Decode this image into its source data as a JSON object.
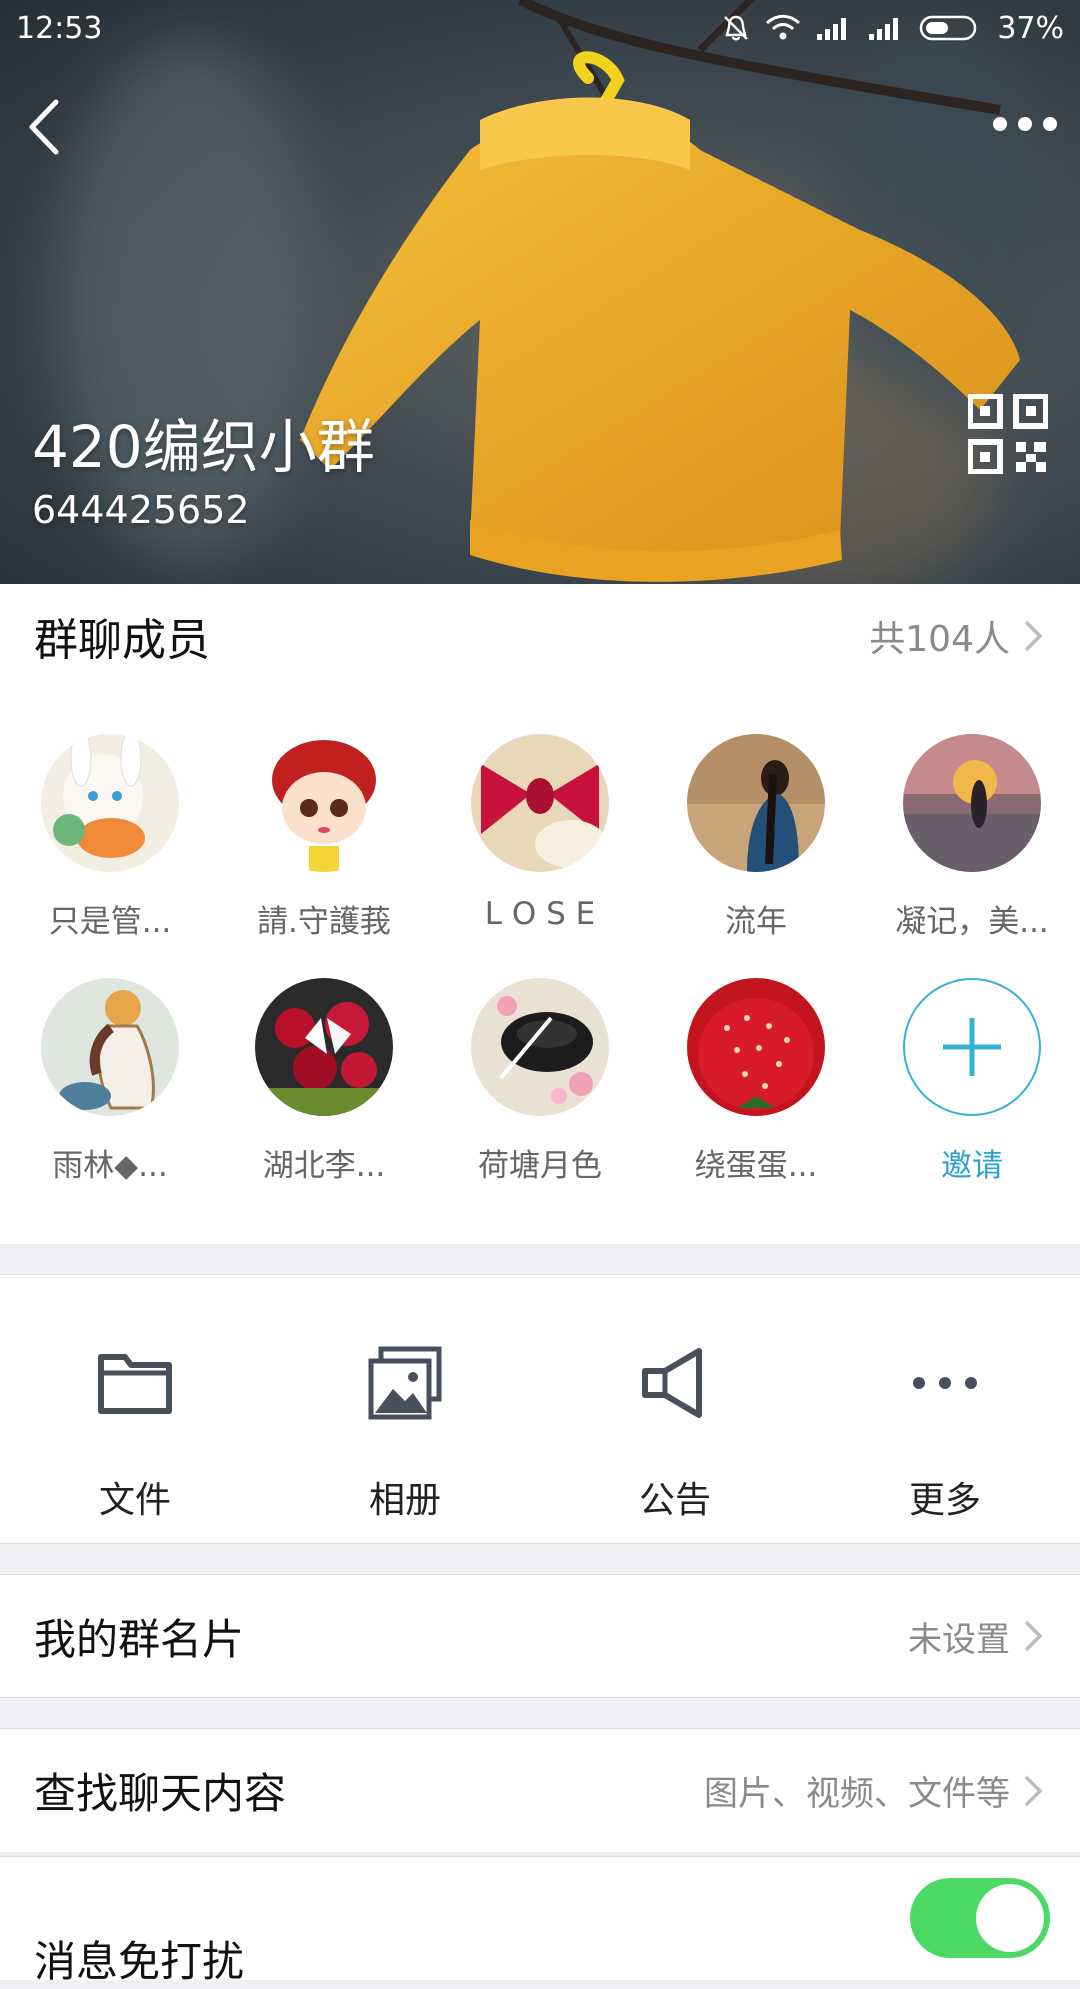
{
  "status_bar": {
    "time": "12:53",
    "battery": "37%"
  },
  "header": {
    "group_name": "420编织小群",
    "group_number": "644425652"
  },
  "members": {
    "title": "群聊成员",
    "count_label": "共104人",
    "list": [
      {
        "name": "只是管...",
        "avatar": "anime-bunny-girl"
      },
      {
        "name": "請.守護莪",
        "avatar": "cartoon-boy"
      },
      {
        "name": "L O S E",
        "avatar": "red-knit-bow"
      },
      {
        "name": "流年",
        "avatar": "silhouette-girl"
      },
      {
        "name": "凝记，美...",
        "avatar": "sunset-figure"
      },
      {
        "name": "雨林◆...",
        "avatar": "illustrated-girl"
      },
      {
        "name": "湖北李...",
        "avatar": "flower-bouquet"
      },
      {
        "name": "荷塘月色",
        "avatar": "tea-cup-flowers"
      },
      {
        "name": "绕蛋蛋...",
        "avatar": "strawberry"
      }
    ],
    "invite_label": "邀请"
  },
  "actions": [
    {
      "label": "文件",
      "icon": "folder-icon"
    },
    {
      "label": "相册",
      "icon": "album-icon"
    },
    {
      "label": "公告",
      "icon": "megaphone-icon"
    },
    {
      "label": "更多",
      "icon": "more-dots-icon"
    }
  ],
  "rows": {
    "card": {
      "title": "我的群名片",
      "value": "未设置"
    },
    "search": {
      "title": "查找聊天内容",
      "value": "图片、视频、文件等"
    },
    "mute": {
      "title": "消息免打扰",
      "enabled": true
    }
  },
  "colors": {
    "accent": "#2aa3d0",
    "toggle_on": "#4cd964",
    "sweater": "#f0a92a"
  }
}
